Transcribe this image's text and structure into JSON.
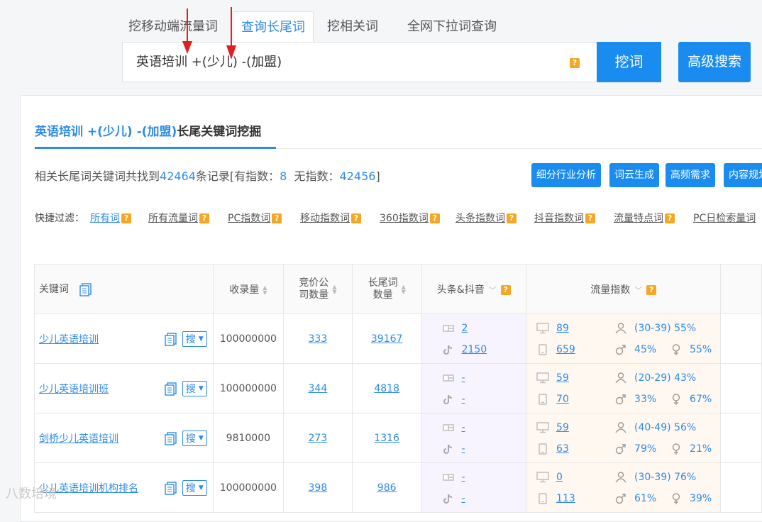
{
  "tabs": [
    {
      "label": "挖移动端流量词"
    },
    {
      "label": "查询长尾词"
    },
    {
      "label": "挖相关词"
    },
    {
      "label": "全网下拉词查询"
    }
  ],
  "search": {
    "value": "英语培训 +(少儿) -(加盟)",
    "help": "?"
  },
  "buttons": {
    "dig": "挖词",
    "advanced": "高级搜索"
  },
  "panel": {
    "title_keyword": "英语培训 +(少儿) -(加盟)",
    "title_suffix": "长尾关键词挖掘"
  },
  "summary": {
    "prefix": "相关长尾词关键词共找到",
    "total": "42464",
    "mid": "条记录[有指数：",
    "with_index": "8",
    "mid2": "  无指数：",
    "without_index": "42456",
    "suffix": "]"
  },
  "actions": [
    "细分行业分析",
    "词云生成",
    "高频需求",
    "内容规划"
  ],
  "filters": {
    "label": "快捷过滤：",
    "items": [
      "所有词",
      "所有流量词",
      "PC指数词",
      "移动指数词",
      "360指数词",
      "头条指数词",
      "抖音指数词",
      "流量特点词",
      "PC日检索量词"
    ]
  },
  "table": {
    "headers": {
      "keyword": "关键词",
      "indexed": "收录量",
      "bidders_line1": "竞价公",
      "bidders_line2": "司数量",
      "longtail_line1": "长尾词",
      "longtail_line2": "数量",
      "toutiao": "头条&抖音",
      "traffic": "流量指数"
    },
    "search_btn": "搜",
    "rows": [
      {
        "keyword": "少儿英语培训",
        "indexed": "100000000",
        "bidders": "333",
        "longtail": "39167",
        "toutiao": "2",
        "douyin": "2150",
        "pc": "89",
        "mobile": "659",
        "age": "(30-39) 55%",
        "male": "45%",
        "female": "55%"
      },
      {
        "keyword": "少儿英语培训班",
        "indexed": "100000000",
        "bidders": "344",
        "longtail": "4818",
        "toutiao": "-",
        "douyin": "-",
        "pc": "59",
        "mobile": "70",
        "age": "(20-29) 43%",
        "male": "33%",
        "female": "67%"
      },
      {
        "keyword": "剑桥少儿英语培训",
        "indexed": "9810000",
        "bidders": "273",
        "longtail": "1316",
        "toutiao": "-",
        "douyin": "-",
        "pc": "59",
        "mobile": "63",
        "age": "(40-49) 56%",
        "male": "79%",
        "female": "21%"
      },
      {
        "keyword": "少儿英语培训机构排名",
        "indexed": "100000000",
        "bidders": "398",
        "longtail": "986",
        "toutiao": "-",
        "douyin": "-",
        "pc": "0",
        "mobile": "113",
        "age": "(30-39) 76%",
        "male": "61%",
        "female": "39%"
      }
    ]
  },
  "watermark": "八数培境"
}
